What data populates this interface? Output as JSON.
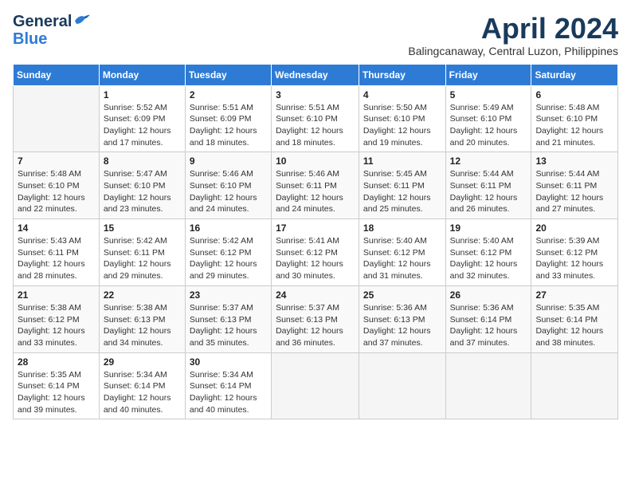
{
  "header": {
    "logo_line1": "General",
    "logo_line2": "Blue",
    "month_title": "April 2024",
    "subtitle": "Balingcanaway, Central Luzon, Philippines"
  },
  "calendar": {
    "headers": [
      "Sunday",
      "Monday",
      "Tuesday",
      "Wednesday",
      "Thursday",
      "Friday",
      "Saturday"
    ],
    "weeks": [
      [
        {
          "day": "",
          "info": ""
        },
        {
          "day": "1",
          "info": "Sunrise: 5:52 AM\nSunset: 6:09 PM\nDaylight: 12 hours\nand 17 minutes."
        },
        {
          "day": "2",
          "info": "Sunrise: 5:51 AM\nSunset: 6:09 PM\nDaylight: 12 hours\nand 18 minutes."
        },
        {
          "day": "3",
          "info": "Sunrise: 5:51 AM\nSunset: 6:10 PM\nDaylight: 12 hours\nand 18 minutes."
        },
        {
          "day": "4",
          "info": "Sunrise: 5:50 AM\nSunset: 6:10 PM\nDaylight: 12 hours\nand 19 minutes."
        },
        {
          "day": "5",
          "info": "Sunrise: 5:49 AM\nSunset: 6:10 PM\nDaylight: 12 hours\nand 20 minutes."
        },
        {
          "day": "6",
          "info": "Sunrise: 5:48 AM\nSunset: 6:10 PM\nDaylight: 12 hours\nand 21 minutes."
        }
      ],
      [
        {
          "day": "7",
          "info": "Sunrise: 5:48 AM\nSunset: 6:10 PM\nDaylight: 12 hours\nand 22 minutes."
        },
        {
          "day": "8",
          "info": "Sunrise: 5:47 AM\nSunset: 6:10 PM\nDaylight: 12 hours\nand 23 minutes."
        },
        {
          "day": "9",
          "info": "Sunrise: 5:46 AM\nSunset: 6:10 PM\nDaylight: 12 hours\nand 24 minutes."
        },
        {
          "day": "10",
          "info": "Sunrise: 5:46 AM\nSunset: 6:11 PM\nDaylight: 12 hours\nand 24 minutes."
        },
        {
          "day": "11",
          "info": "Sunrise: 5:45 AM\nSunset: 6:11 PM\nDaylight: 12 hours\nand 25 minutes."
        },
        {
          "day": "12",
          "info": "Sunrise: 5:44 AM\nSunset: 6:11 PM\nDaylight: 12 hours\nand 26 minutes."
        },
        {
          "day": "13",
          "info": "Sunrise: 5:44 AM\nSunset: 6:11 PM\nDaylight: 12 hours\nand 27 minutes."
        }
      ],
      [
        {
          "day": "14",
          "info": "Sunrise: 5:43 AM\nSunset: 6:11 PM\nDaylight: 12 hours\nand 28 minutes."
        },
        {
          "day": "15",
          "info": "Sunrise: 5:42 AM\nSunset: 6:11 PM\nDaylight: 12 hours\nand 29 minutes."
        },
        {
          "day": "16",
          "info": "Sunrise: 5:42 AM\nSunset: 6:12 PM\nDaylight: 12 hours\nand 29 minutes."
        },
        {
          "day": "17",
          "info": "Sunrise: 5:41 AM\nSunset: 6:12 PM\nDaylight: 12 hours\nand 30 minutes."
        },
        {
          "day": "18",
          "info": "Sunrise: 5:40 AM\nSunset: 6:12 PM\nDaylight: 12 hours\nand 31 minutes."
        },
        {
          "day": "19",
          "info": "Sunrise: 5:40 AM\nSunset: 6:12 PM\nDaylight: 12 hours\nand 32 minutes."
        },
        {
          "day": "20",
          "info": "Sunrise: 5:39 AM\nSunset: 6:12 PM\nDaylight: 12 hours\nand 33 minutes."
        }
      ],
      [
        {
          "day": "21",
          "info": "Sunrise: 5:38 AM\nSunset: 6:12 PM\nDaylight: 12 hours\nand 33 minutes."
        },
        {
          "day": "22",
          "info": "Sunrise: 5:38 AM\nSunset: 6:13 PM\nDaylight: 12 hours\nand 34 minutes."
        },
        {
          "day": "23",
          "info": "Sunrise: 5:37 AM\nSunset: 6:13 PM\nDaylight: 12 hours\nand 35 minutes."
        },
        {
          "day": "24",
          "info": "Sunrise: 5:37 AM\nSunset: 6:13 PM\nDaylight: 12 hours\nand 36 minutes."
        },
        {
          "day": "25",
          "info": "Sunrise: 5:36 AM\nSunset: 6:13 PM\nDaylight: 12 hours\nand 37 minutes."
        },
        {
          "day": "26",
          "info": "Sunrise: 5:36 AM\nSunset: 6:14 PM\nDaylight: 12 hours\nand 37 minutes."
        },
        {
          "day": "27",
          "info": "Sunrise: 5:35 AM\nSunset: 6:14 PM\nDaylight: 12 hours\nand 38 minutes."
        }
      ],
      [
        {
          "day": "28",
          "info": "Sunrise: 5:35 AM\nSunset: 6:14 PM\nDaylight: 12 hours\nand 39 minutes."
        },
        {
          "day": "29",
          "info": "Sunrise: 5:34 AM\nSunset: 6:14 PM\nDaylight: 12 hours\nand 40 minutes."
        },
        {
          "day": "30",
          "info": "Sunrise: 5:34 AM\nSunset: 6:14 PM\nDaylight: 12 hours\nand 40 minutes."
        },
        {
          "day": "",
          "info": ""
        },
        {
          "day": "",
          "info": ""
        },
        {
          "day": "",
          "info": ""
        },
        {
          "day": "",
          "info": ""
        }
      ]
    ]
  }
}
